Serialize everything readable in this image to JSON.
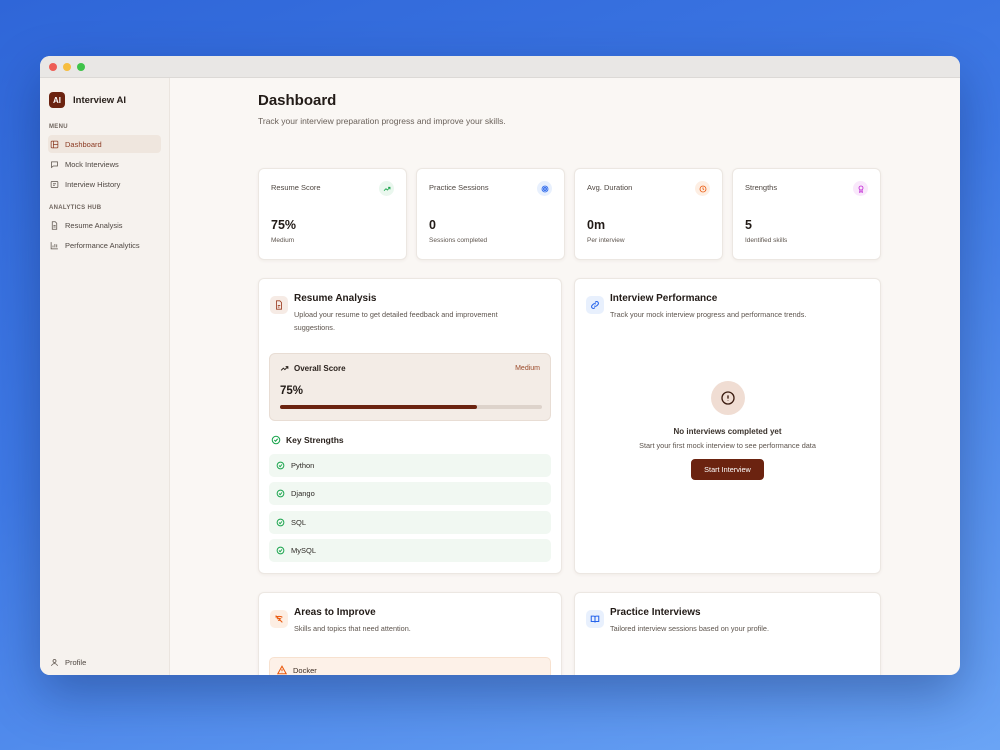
{
  "app": {
    "logo_text": "AI",
    "name": "Interview AI"
  },
  "sidebar": {
    "menu_label": "MENU",
    "menu_items": [
      {
        "label": "Dashboard",
        "icon": "dashboard-icon",
        "active": true
      },
      {
        "label": "Mock Interviews",
        "icon": "message-icon",
        "active": false
      },
      {
        "label": "Interview History",
        "icon": "history-icon",
        "active": false
      }
    ],
    "analytics_label": "ANALYTICS HUB",
    "analytics_items": [
      {
        "label": "Resume Analysis",
        "icon": "document-icon"
      },
      {
        "label": "Performance Analytics",
        "icon": "bar-chart-icon"
      }
    ],
    "profile_label": "Profile"
  },
  "header": {
    "title": "Dashboard",
    "subtitle": "Track your interview preparation progress and improve your skills."
  },
  "stats": [
    {
      "label": "Resume Score",
      "value": "75%",
      "note": "Medium",
      "icon": "trending-up-icon",
      "color": "#16a34a"
    },
    {
      "label": "Practice Sessions",
      "value": "0",
      "note": "Sessions completed",
      "icon": "target-icon",
      "color": "#2563eb"
    },
    {
      "label": "Avg. Duration",
      "value": "0m",
      "note": "Per interview",
      "icon": "clock-icon",
      "color": "#ea580c"
    },
    {
      "label": "Strengths",
      "value": "5",
      "note": "Identified skills",
      "icon": "award-icon",
      "color": "#c026d3"
    }
  ],
  "resume_analysis": {
    "title": "Resume Analysis",
    "description": "Upload your resume to get detailed feedback and improvement suggestions.",
    "overall_label": "Overall Score",
    "level": "Medium",
    "score_text": "75%",
    "score_percent": 75,
    "strengths_title": "Key Strengths",
    "strengths": [
      "Python",
      "Django",
      "SQL",
      "MySQL"
    ]
  },
  "interview_performance": {
    "title": "Interview Performance",
    "description": "Track your mock interview progress and performance trends.",
    "empty_title": "No interviews completed yet",
    "empty_subtitle": "Start your first mock interview to see performance data",
    "button_label": "Start Interview"
  },
  "areas_to_improve": {
    "title": "Areas to Improve",
    "description": "Skills and topics that need attention.",
    "items": [
      "Docker"
    ]
  },
  "practice_interviews": {
    "title": "Practice Interviews",
    "description": "Tailored interview sessions based on your profile."
  },
  "colors": {
    "brand": "#6b2310",
    "page_bg": "#faf7f4"
  }
}
